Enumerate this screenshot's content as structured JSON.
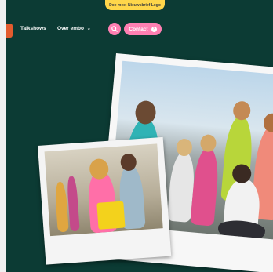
{
  "banner": {
    "text": "Doe mee: Nieuwsbrief Logo"
  },
  "nav": {
    "items": [
      {
        "label": "Talkshows"
      },
      {
        "label": "Over embo"
      }
    ],
    "contact_label": "Contact"
  },
  "icons": {
    "search": "search-icon",
    "contact": "arrow-right-icon",
    "chevron": "chevron-down-icon"
  },
  "colors": {
    "hero_background": "#0c3b34",
    "accent_pink": "#ff7fb2",
    "banner_yellow": "#ffd64a",
    "menu_tab_orange": "#e35b2e"
  }
}
